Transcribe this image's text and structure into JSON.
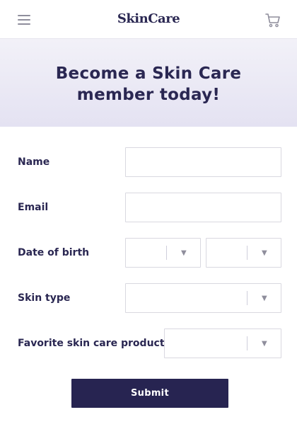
{
  "header": {
    "brand": "SkinCare",
    "menu_icon": "hamburger-menu-icon",
    "cart_icon": "shopping-cart-icon"
  },
  "hero": {
    "title_line1": "Become a Skin Care",
    "title_line2": "member today!"
  },
  "form": {
    "name_label": "Name",
    "name_value": "",
    "email_label": "Email",
    "email_value": "",
    "dob_label": "Date of birth",
    "dob_month_value": "",
    "dob_year_value": "",
    "skin_type_label": "Skin type",
    "skin_type_value": "",
    "favorite_product_label": "Favorite skin care product",
    "favorite_product_value": "",
    "dropdown_caret": "▼",
    "submit_label": "Submit"
  },
  "colors": {
    "brand": "#2a2752",
    "button": "#272451",
    "hero_gradient_top": "#f2f1f8",
    "hero_gradient_bottom": "#e4e2f2",
    "border": "#d9d8e0"
  }
}
